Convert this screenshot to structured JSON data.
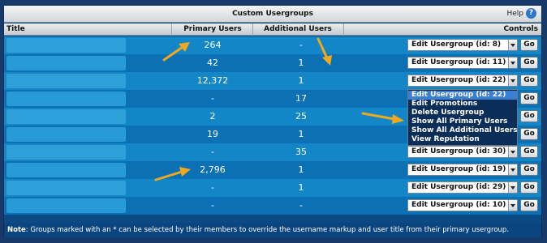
{
  "header": {
    "title": "Custom Usergroups",
    "help_label": "Help",
    "help_glyph": "?"
  },
  "columns": {
    "title": "Title",
    "primary": "Primary Users",
    "additional": "Additional Users",
    "controls": "Controls"
  },
  "go_label": "Go",
  "rows": [
    {
      "primary": "264",
      "additional": "-",
      "control": "Edit Usergroup (id: 8)"
    },
    {
      "primary": "42",
      "additional": "1",
      "control": "Edit Usergroup (id: 11)"
    },
    {
      "primary": "12,372",
      "additional": "1",
      "control": "Edit Usergroup (id: 22)"
    },
    {
      "primary": "-",
      "additional": "17",
      "control": ""
    },
    {
      "primary": "2",
      "additional": "25",
      "control": ""
    },
    {
      "primary": "19",
      "additional": "1",
      "control": ""
    },
    {
      "primary": "-",
      "additional": "35",
      "control": "Edit Usergroup (id: 30)"
    },
    {
      "primary": "2,796",
      "additional": "1",
      "control": "Edit Usergroup (id: 19)"
    },
    {
      "primary": "-",
      "additional": "1",
      "control": "Edit Usergroup (id: 29)"
    },
    {
      "primary": "-",
      "additional": "-",
      "control": "Edit Usergroup (id: 10)"
    }
  ],
  "dropdown": {
    "options": [
      "Edit Usergroup (id: 22)",
      "Edit Promotions",
      "Delete Usergroup",
      "Show All Primary Users",
      "Show All Additional Users",
      "View Reputation"
    ],
    "highlighted_index": 0
  },
  "note": {
    "label": "Note",
    "text": ": Groups marked with an * can be selected by their members to override the username markup and user title from their primary usergroup."
  },
  "colors": {
    "arrow": "#f0a81e",
    "menu_highlight": "#3b7fd2"
  }
}
